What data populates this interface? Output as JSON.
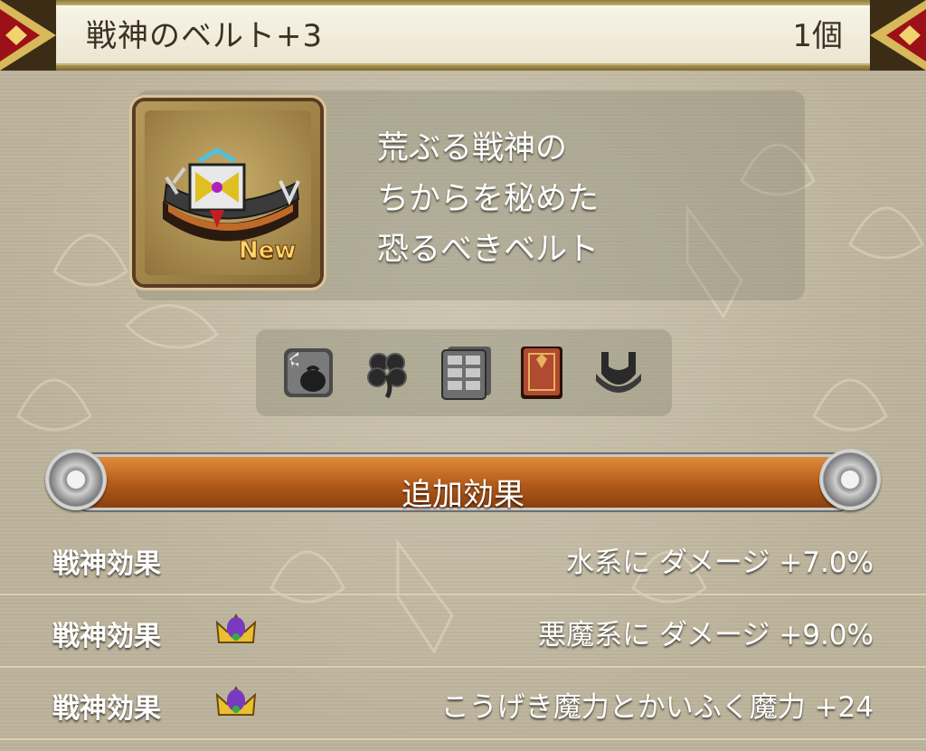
{
  "header": {
    "item_name": "戦神のベルト+3",
    "count": "1個"
  },
  "item": {
    "badge": "New",
    "icon": "belt-icon",
    "description_lines": [
      "荒ぶる戦神の",
      "ちからを秘めた",
      "恐るべきベルト"
    ]
  },
  "usability_icons": [
    "trade-bag-icon",
    "clover-icon",
    "storage-drawer-icon",
    "book-icon",
    "belt-slot-icon"
  ],
  "section": {
    "title": "追加効果"
  },
  "effects": [
    {
      "label": "戦神効果",
      "value": "水系に ダメージ +7.0%",
      "crown": false
    },
    {
      "label": "戦神効果",
      "value": "悪魔系に ダメージ +9.0%",
      "crown": true
    },
    {
      "label": "戦神効果",
      "value": "こうげき魔力とかいふく魔力 +24",
      "crown": true
    }
  ],
  "colors": {
    "accent_orange": "#b25a1a",
    "gold": "#c9b060",
    "corner_red": "#b0101a"
  }
}
